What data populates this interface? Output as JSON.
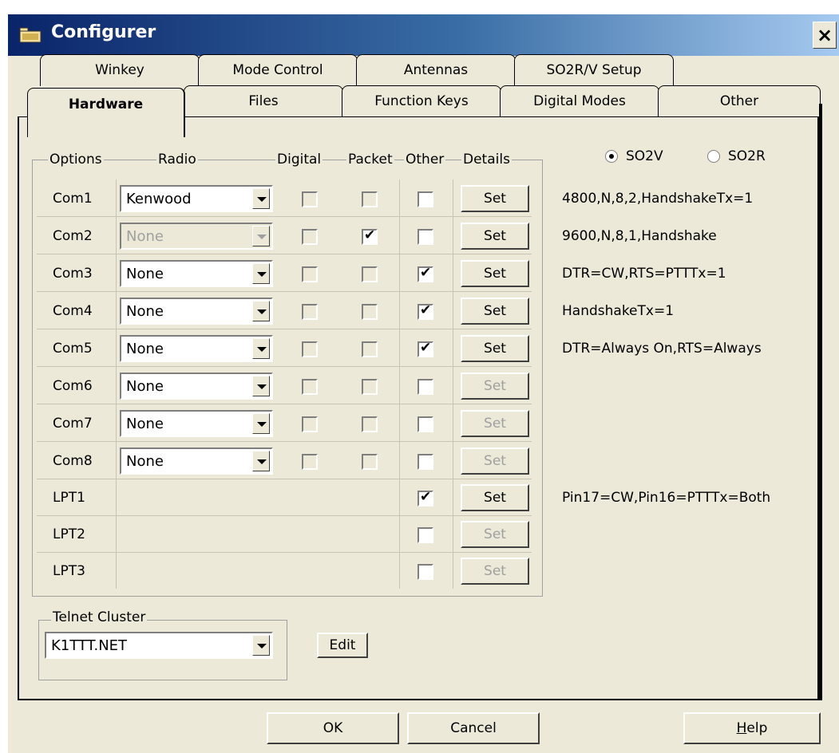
{
  "window": {
    "title": "Configurer",
    "close": "×"
  },
  "tabs_back": [
    "Winkey",
    "Mode Control",
    "Antennas",
    "SO2R/V Setup"
  ],
  "tabs_front": [
    "Hardware",
    "Files",
    "Function Keys",
    "Digital Modes",
    "Other"
  ],
  "headers": {
    "options": "Options",
    "radio": "Radio",
    "digital": "Digital",
    "packet": "Packet",
    "other": "Other",
    "details": "Details"
  },
  "mode": {
    "so2v": "SO2V",
    "so2r": "SO2R",
    "selected": "SO2V"
  },
  "set_label": "Set",
  "ports": [
    {
      "name": "Com1",
      "radio": "Kenwood",
      "digital": false,
      "packet": false,
      "other": false,
      "set_enabled": true,
      "settings": "4800,N,8,2,HandshakeTx=1"
    },
    {
      "name": "Com2",
      "radio": "None",
      "digital": false,
      "packet": true,
      "other": false,
      "set_enabled": true,
      "settings": "9600,N,8,1,Handshake"
    },
    {
      "name": "Com3",
      "radio": "None",
      "digital": false,
      "packet": false,
      "other": true,
      "set_enabled": true,
      "settings": "DTR=CW,RTS=PTTTx=1"
    },
    {
      "name": "Com4",
      "radio": "None",
      "digital": false,
      "packet": false,
      "other": true,
      "set_enabled": true,
      "settings": "HandshakeTx=1"
    },
    {
      "name": "Com5",
      "radio": "None",
      "digital": false,
      "packet": false,
      "other": true,
      "set_enabled": true,
      "settings": "DTR=Always On,RTS=Always"
    },
    {
      "name": "Com6",
      "radio": "None",
      "digital": false,
      "packet": false,
      "other": false,
      "set_enabled": false,
      "settings": ""
    },
    {
      "name": "Com7",
      "radio": "None",
      "digital": false,
      "packet": false,
      "other": false,
      "set_enabled": false,
      "settings": ""
    },
    {
      "name": "Com8",
      "radio": "None",
      "digital": false,
      "packet": false,
      "other": false,
      "set_enabled": false,
      "settings": ""
    },
    {
      "name": "LPT1",
      "other": true,
      "set_enabled": true,
      "settings": "Pin17=CW,Pin16=PTTTx=Both"
    },
    {
      "name": "LPT2",
      "other": false,
      "set_enabled": false,
      "settings": ""
    },
    {
      "name": "LPT3",
      "other": false,
      "set_enabled": false,
      "settings": ""
    }
  ],
  "telnet": {
    "label": "Telnet Cluster",
    "value": "K1TTT.NET",
    "edit": "Edit"
  },
  "buttons": {
    "ok": "OK",
    "cancel": "Cancel",
    "help_h": "H",
    "help_rest": "elp"
  }
}
